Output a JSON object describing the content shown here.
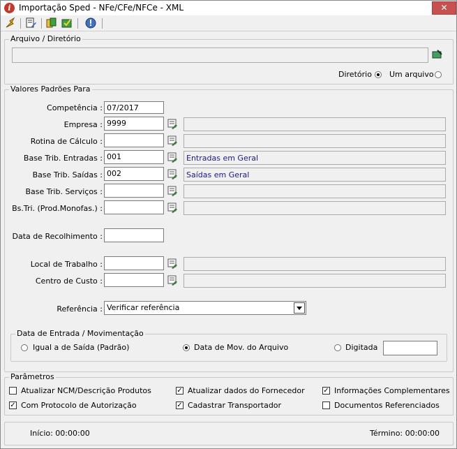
{
  "window": {
    "title": "Importação Sped - NFe/CFe/NFCe - XML",
    "close_label": "✕"
  },
  "toolbar": {
    "icons": [
      "run-icon",
      "edit-icon",
      "copy-icon",
      "save-icon",
      "info-icon"
    ]
  },
  "arquivo": {
    "legend": "Arquivo / Diretório",
    "path_value": "",
    "diretorio_label": "Diretório",
    "um_arquivo_label": "Um arquivo",
    "mode": "Diretório"
  },
  "valores": {
    "legend": "Valores Padrões Para",
    "fields": [
      {
        "label": "Competência :",
        "value": "07/2017",
        "desc": null
      },
      {
        "label": "Empresa :",
        "value": "9999",
        "desc": ""
      },
      {
        "label": "Rotina de Cálculo :",
        "value": "",
        "desc": ""
      },
      {
        "label": "Base Trib. Entradas :",
        "value": "001",
        "desc": "Entradas em Geral"
      },
      {
        "label": "Base Trib. Saídas :",
        "value": "002",
        "desc": "Saídas em Geral"
      },
      {
        "label": "Base Trib. Serviços :",
        "value": "",
        "desc": ""
      },
      {
        "label": "Bs.Tri. (Prod.Monofas.) :",
        "value": "",
        "desc": ""
      }
    ],
    "data_recolhimento_label": "Data de Recolhimento :",
    "data_recolhimento_value": "",
    "local_trabalho_label": "Local de Trabalho :",
    "local_trabalho_value": "",
    "local_trabalho_desc": "",
    "centro_custo_label": "Centro de Custo :",
    "centro_custo_value": "",
    "centro_custo_desc": "",
    "referencia_label": "Referência :",
    "referencia_value": "Verificar referência"
  },
  "data_entrada": {
    "legend": "Data de Entrada / Movimentação",
    "options": [
      "Igual a de Saída (Padrão)",
      "Data de Mov. do Arquivo",
      "Digitada"
    ],
    "selected": "Data de Mov. do Arquivo",
    "digitada_value": ""
  },
  "parametros": {
    "legend": "Parâmetros",
    "items": [
      {
        "label": "Atualizar NCM/Descrição Produtos",
        "checked": false
      },
      {
        "label": "Atualizar dados do Fornecedor",
        "checked": true
      },
      {
        "label": "Informações Complementares",
        "checked": true
      },
      {
        "label": "Com Protocolo de Autorização",
        "checked": true
      },
      {
        "label": "Cadastrar Transportador",
        "checked": true
      },
      {
        "label": "Documentos Referenciados",
        "checked": false
      }
    ]
  },
  "status": {
    "inicio": "Início: 00:00:00",
    "termino": "Término: 00:00:00"
  },
  "colors": {
    "accent": "#1a1a80",
    "close": "#c75050"
  }
}
